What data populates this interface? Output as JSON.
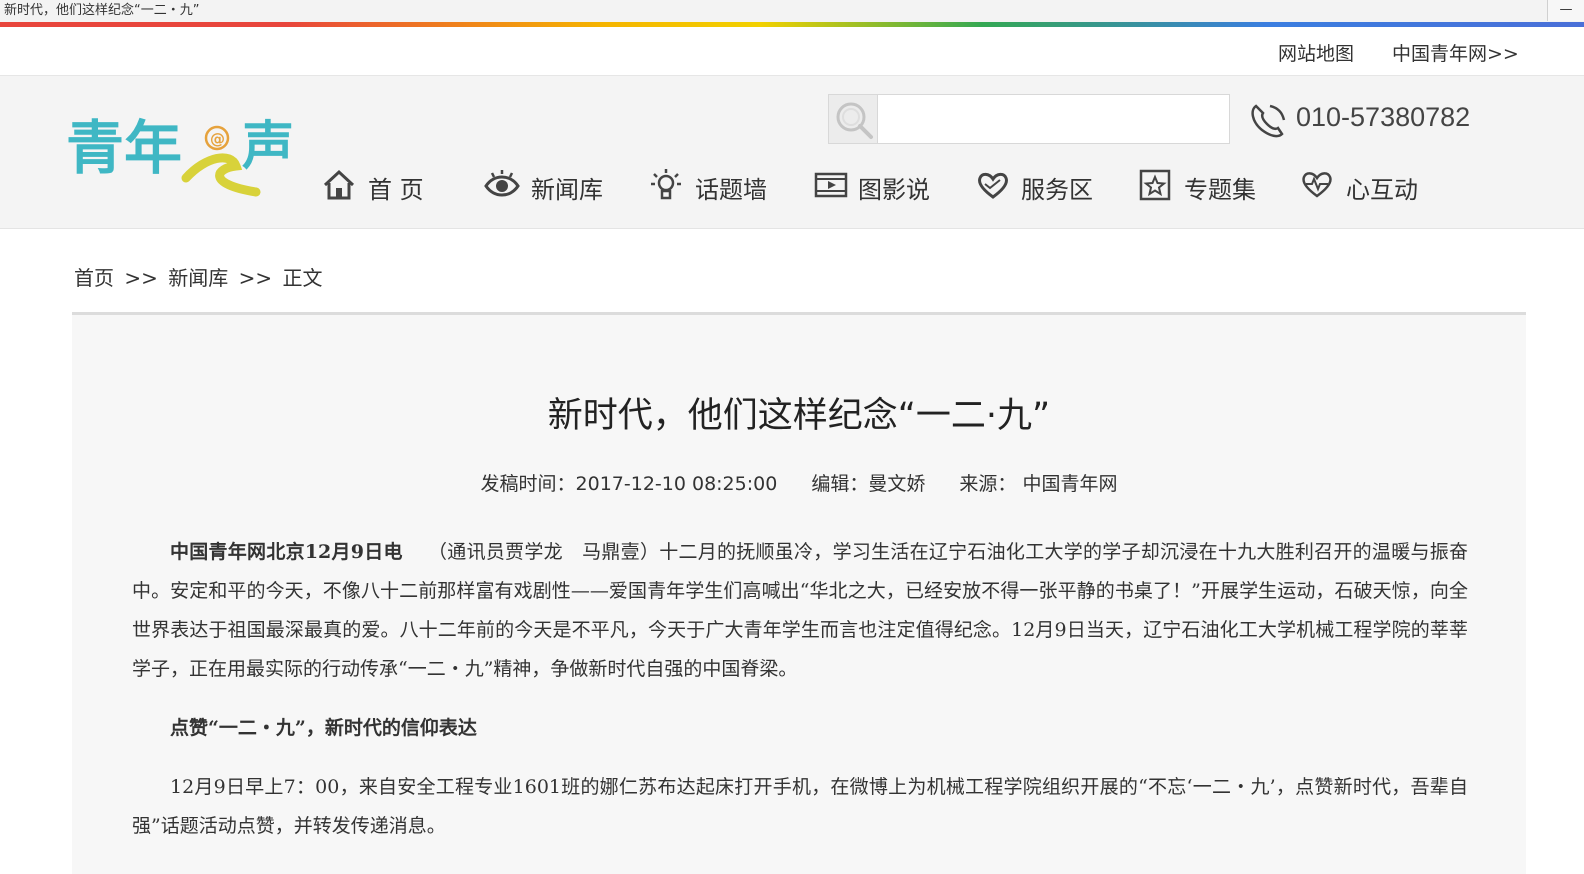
{
  "window": {
    "title": "新时代，他们这样纪念“一二・九”",
    "minimize_glyph": "—"
  },
  "topbar": {
    "sitemap": "网站地图",
    "cyol_link": "中国青年网>>"
  },
  "header": {
    "logo_alt": "青年@之声",
    "search": {
      "placeholder": "",
      "value": ""
    },
    "phone": "010-57380782"
  },
  "nav": {
    "items": [
      {
        "label": "首 页",
        "icon": "home-icon"
      },
      {
        "label": "新闻库",
        "icon": "eye-icon"
      },
      {
        "label": "话题墙",
        "icon": "lightbulb-icon"
      },
      {
        "label": "图影说",
        "icon": "film-icon"
      },
      {
        "label": "服务区",
        "icon": "heart-hands-icon"
      },
      {
        "label": "专题集",
        "icon": "star-box-icon"
      },
      {
        "label": "心互动",
        "icon": "heartbeat-icon"
      }
    ]
  },
  "breadcrumb": {
    "home": "首页",
    "sep1": ">>",
    "news": "新闻库",
    "sep2": ">>",
    "current": "正文"
  },
  "article": {
    "title": "新时代，他们这样纪念“一二·九”",
    "meta": {
      "time": "发稿时间：2017-12-10 08:25:00",
      "editor": "编辑：曼文娇",
      "source": "来源： 中国青年网"
    },
    "lead_bold": "中国青年网北京12月9日电",
    "para1": "（通讯员贾学龙　马鼎壹）十二月的抚顺虽冷，学习生活在辽宁石油化工大学的学子却沉浸在十九大胜利召开的温暖与振奋中。安定和平的今天，不像八十二前那样富有戏剧性——爱国青年学生们高喊出“华北之大，已经安放不得一张平静的书桌了！”开展学生运动，石破天惊，向全世界表达于祖国最深最真的爱。八十二年前的今天是不平凡，今天于广大青年学生而言也注定值得纪念。12月9日当天，辽宁石油化工大学机械工程学院的莘莘学子，正在用最实际的行动传承“一二・九”精神，争做新时代自强的中国脊梁。",
    "subheading": "点赞“一二・九”，新时代的信仰表达",
    "para2": "12月9日早上7：00，来自安全工程专业1601班的娜仁苏布达起床打开手机，在微博上为机械工程学院组织开展的“不忘‘一二・九’，点赞新时代，吾辈自强”话题活动点赞，并转发传递消息。"
  }
}
